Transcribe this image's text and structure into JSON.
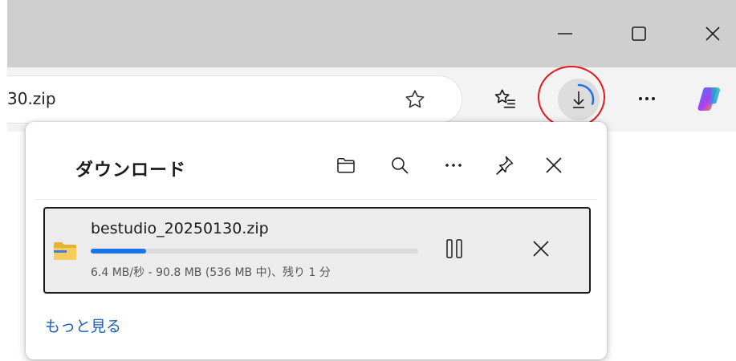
{
  "window": {
    "minimize_icon": "minimize-icon",
    "maximize_icon": "maximize-icon",
    "close_icon": "close-icon"
  },
  "address_bar": {
    "url_fragment": "30.zip"
  },
  "toolbar": {
    "icons": [
      "star-icon",
      "favorites-icon",
      "download-icon",
      "more-icon",
      "copilot-icon"
    ],
    "download_progress": 0.3,
    "colors": {
      "ring_highlight": "#e01a1a",
      "progress": "#1a73e8",
      "copilot_start": "#2f80ff",
      "copilot_end": "#f5a623"
    }
  },
  "downloads_panel": {
    "title": "ダウンロード",
    "header_icons": [
      "open-folder-icon",
      "search-icon",
      "more-options-icon",
      "pin-icon",
      "close-icon"
    ],
    "item": {
      "file_name": "bestudio_20250130.zip",
      "status": "6.4 MB/秒 - 90.8 MB (536 MB 中)、残り 1 分",
      "progress": 0.17,
      "icons": [
        "zip-folder-icon",
        "pause-icon",
        "cancel-icon"
      ]
    },
    "more_link": "もっと見る"
  }
}
